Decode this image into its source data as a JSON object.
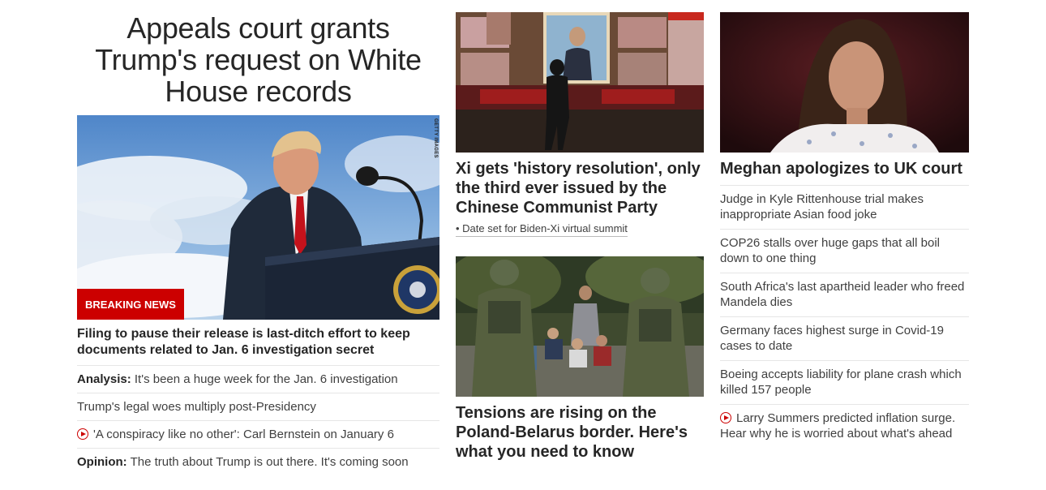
{
  "lead": {
    "headline": "Appeals court grants Trump's request on White House records",
    "image_alt": "Donald Trump speaking at a podium",
    "photo_credit": "GETTY IMAGES",
    "badge": "BREAKING NEWS",
    "subhead": "Filing to pause their release is last-ditch effort to keep documents related to Jan. 6 investigation secret",
    "links": [
      {
        "prefix": "Analysis:",
        "text": "It's been a huge week for the Jan. 6 investigation",
        "video": false
      },
      {
        "prefix": "",
        "text": "Trump's legal woes multiply post-Presidency",
        "video": false
      },
      {
        "prefix": "",
        "text": "'A conspiracy like no other': Carl Bernstein on January 6",
        "video": true
      },
      {
        "prefix": "Opinion:",
        "text": "The truth about Trump is out there. It's coming soon",
        "video": false
      }
    ]
  },
  "middle": {
    "story1": {
      "image_alt": "Person walking past a display of Xi Jinping photographs",
      "title": "Xi gets 'history resolution', only the third ever issued by the Chinese Communist Party",
      "related": "Date set for Biden-Xi virtual summit"
    },
    "story2": {
      "image_alt": "Soldiers and migrants at the Poland-Belarus border",
      "title": "Tensions are rising on the Poland-Belarus border. Here's what you need to know"
    }
  },
  "right": {
    "image_alt": "Meghan, Duchess of Sussex",
    "title": "Meghan apologizes to UK court",
    "links": [
      {
        "text": "Judge in Kyle Rittenhouse trial makes inappropriate Asian food joke",
        "video": false
      },
      {
        "text": "COP26 stalls over huge gaps that all boil down to one thing",
        "video": false
      },
      {
        "text": "South Africa's last apartheid leader who freed Mandela dies",
        "video": false
      },
      {
        "text": "Germany faces highest surge in Covid-19 cases to date",
        "video": false
      },
      {
        "text": "Boeing accepts liability for plane crash which killed 157 people",
        "video": false
      },
      {
        "text": "Larry Summers predicted inflation surge. Hear why he is worried about what's ahead",
        "video": true
      }
    ]
  },
  "colors": {
    "accent": "#cc0000",
    "text": "#262626",
    "divider": "#e6e6e6"
  }
}
